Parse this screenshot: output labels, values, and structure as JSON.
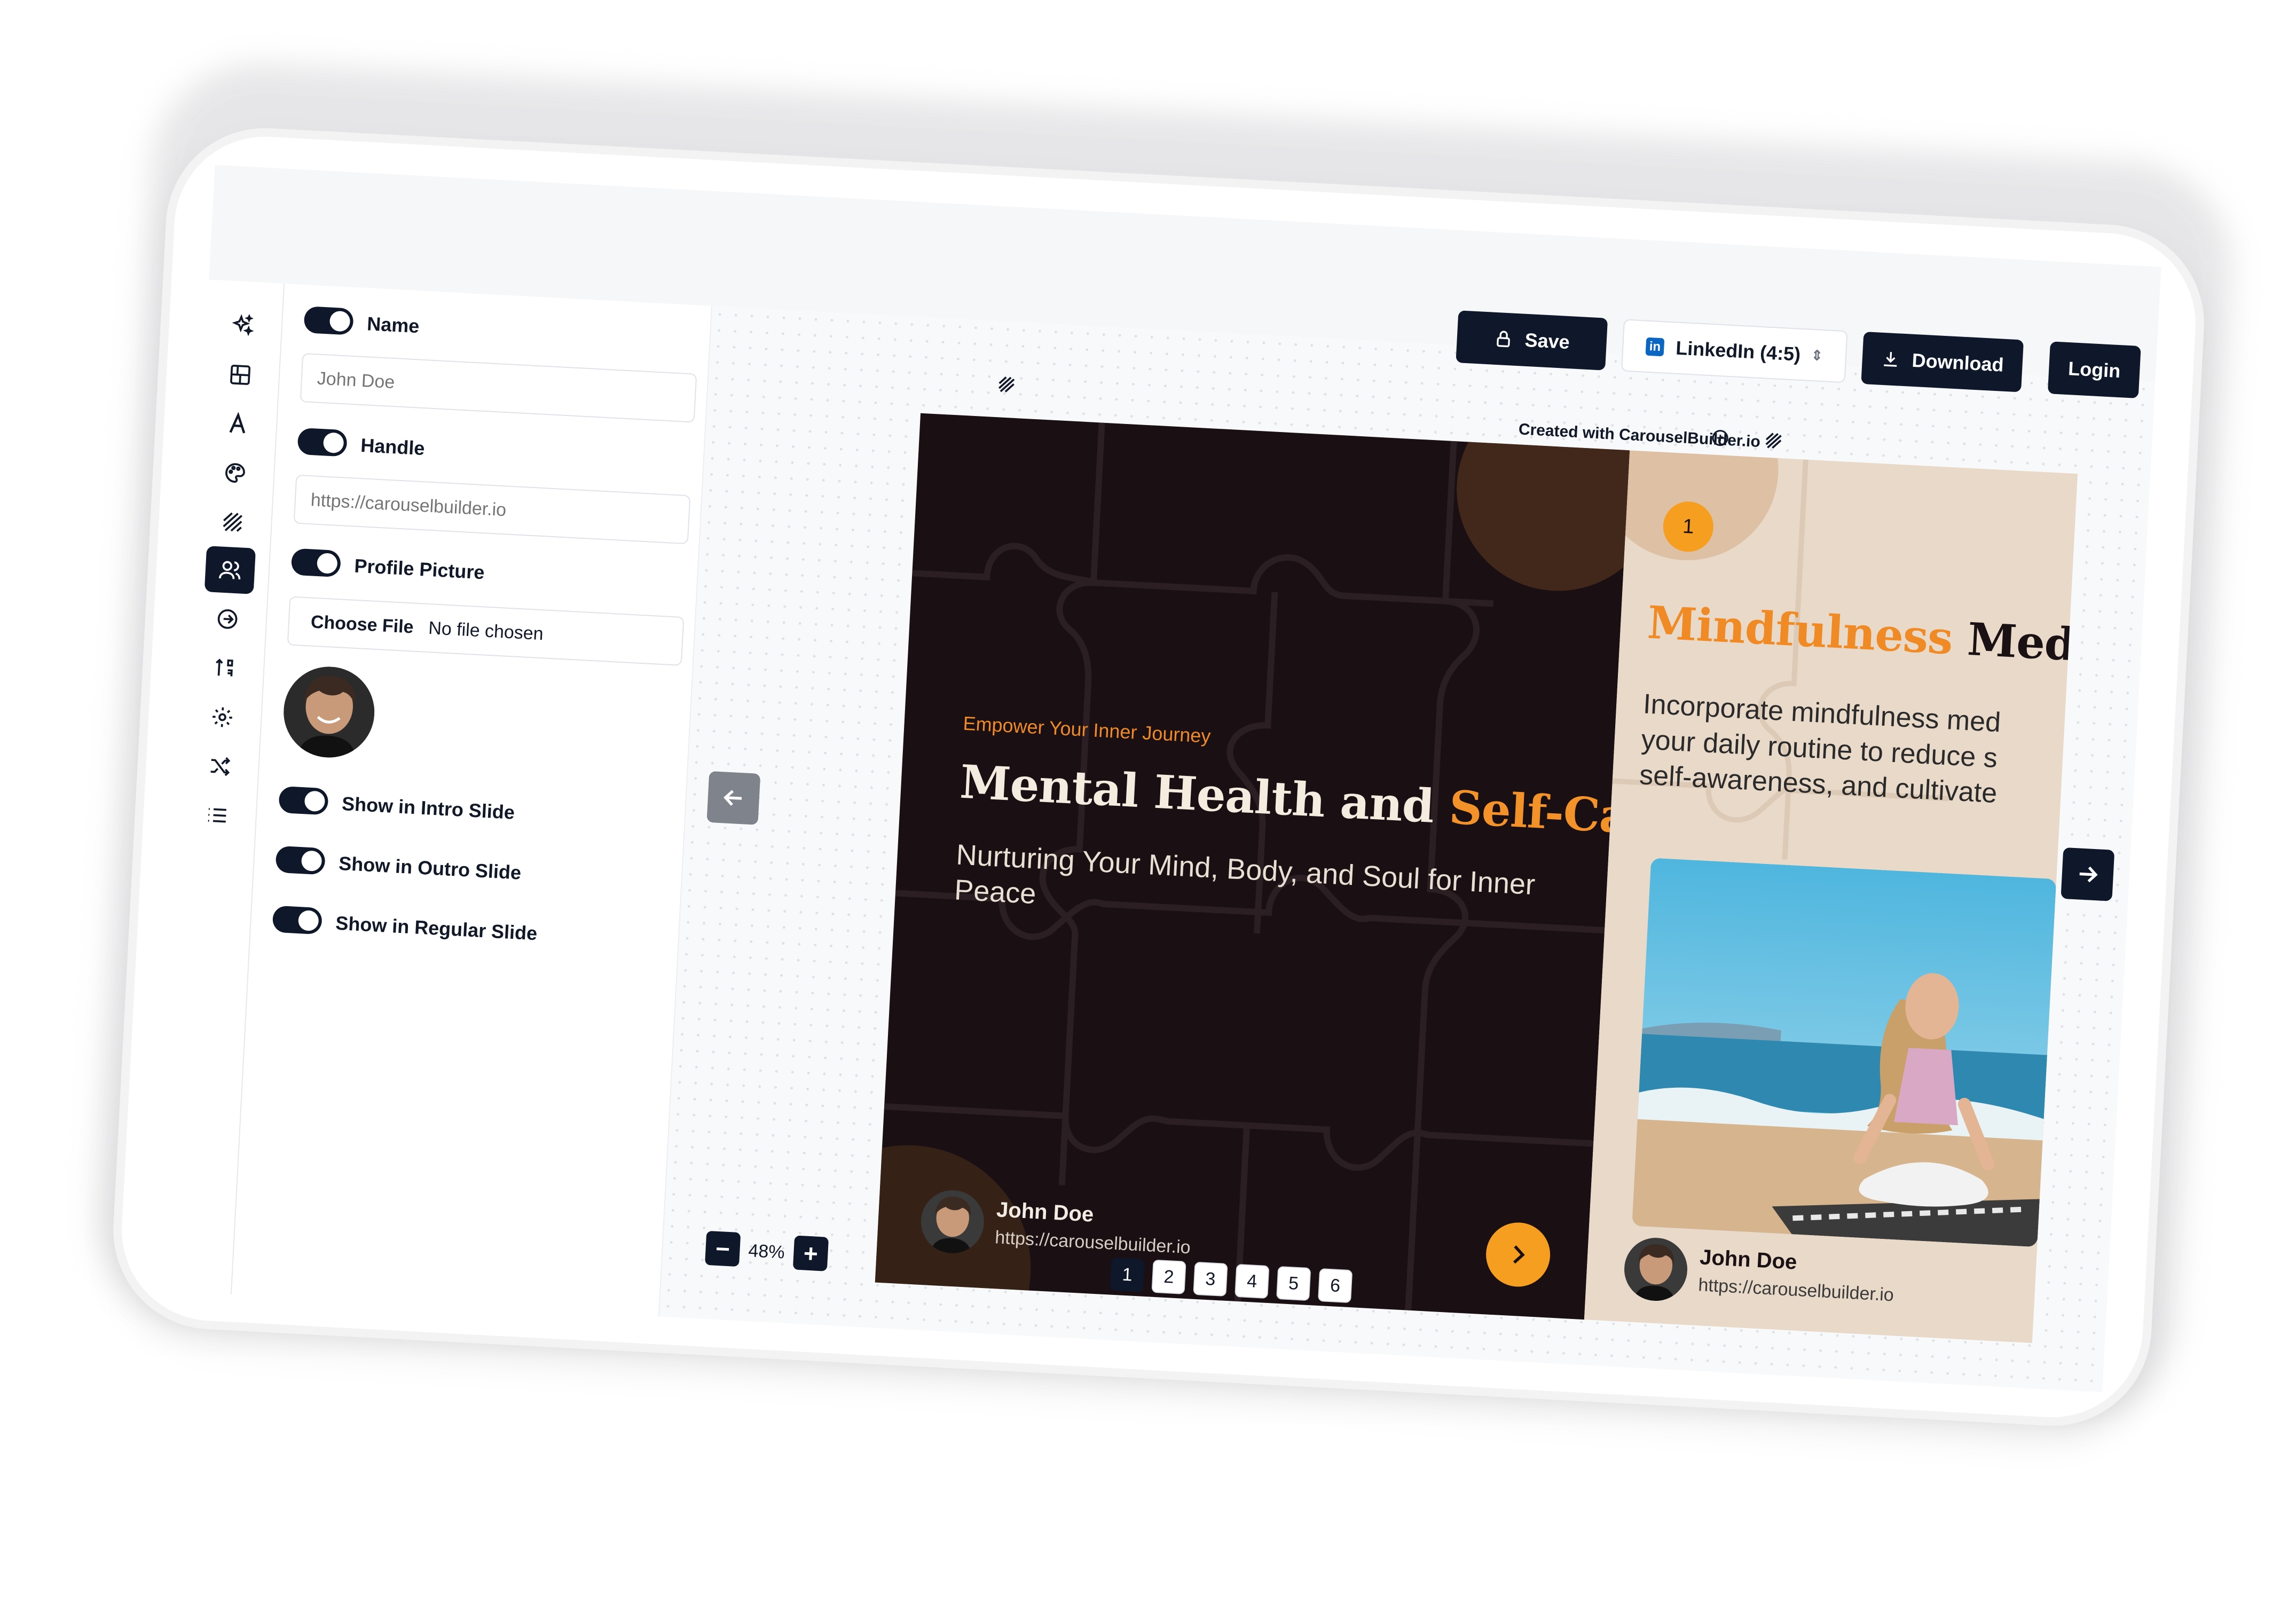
{
  "toolbar": {
    "save_label": "Save",
    "format_label": "LinkedIn (4:5)",
    "download_label": "Download",
    "login_label": "Login"
  },
  "sidebar": {
    "items": [
      {
        "icon": "sparkles-icon"
      },
      {
        "icon": "layout-icon"
      },
      {
        "icon": "typography-icon"
      },
      {
        "icon": "palette-icon"
      },
      {
        "icon": "pattern-icon"
      },
      {
        "icon": "users-icon",
        "active": true
      },
      {
        "icon": "arrow-circle-right-icon"
      },
      {
        "icon": "sort-icon"
      },
      {
        "icon": "gear-icon"
      },
      {
        "icon": "shuffle-icon"
      },
      {
        "icon": "list-icon"
      }
    ]
  },
  "settings": {
    "name_label": "Name",
    "name_placeholder": "John Doe",
    "handle_label": "Handle",
    "handle_placeholder": "https://carouselbuilder.io",
    "profile_picture_label": "Profile Picture",
    "choose_file_label": "Choose File",
    "no_file_text": "No file chosen",
    "show_intro_label": "Show in Intro Slide",
    "show_outro_label": "Show in Outro Slide",
    "show_regular_label": "Show in Regular Slide"
  },
  "slides": [
    {
      "watermark": "Created with CarouselBuilder.io",
      "kicker": "Empower Your Inner Journey",
      "title_main": "Mental Health and ",
      "title_accent": "Self-Care",
      "subtitle": "Nurturing Your Mind, Body, and Soul for Inner Peace",
      "author_name": "John Doe",
      "author_handle": "https://carouselbuilder.io"
    },
    {
      "watermark": "Created with CarouselBuilde",
      "number": "1",
      "title_accent": "Mindfulness",
      "title_main": " Medita",
      "body_lines": [
        "Incorporate mindfulness med",
        "your daily routine to reduce s",
        "self-awareness, and cultivate"
      ],
      "author_name": "John Doe",
      "author_handle": "https://carouselbuilder.io"
    }
  ],
  "zoom": {
    "value": "48%"
  },
  "pagination": {
    "pages": [
      "1",
      "2",
      "3",
      "4",
      "5",
      "6"
    ],
    "active": "1"
  },
  "colors": {
    "dark": "#0f172a",
    "accent": "#f59e1f",
    "slide_bg": "#1a0f13",
    "slide2_bg": "#e9d9c9"
  }
}
